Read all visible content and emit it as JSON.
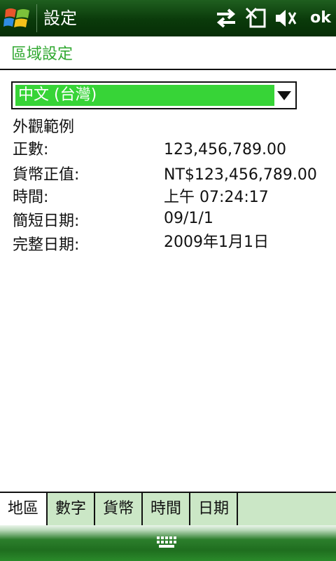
{
  "title_bar": {
    "app_title": "設定",
    "icons": [
      "windows-start-icon",
      "connectivity-icon",
      "no-sim-icon",
      "speaker-muted-icon"
    ],
    "ok_label": "ok"
  },
  "page": {
    "title": "區域設定"
  },
  "locale_select": {
    "value": "中文 (台灣)"
  },
  "sample": {
    "heading": "外觀範例",
    "rows": [
      {
        "label": "正數:",
        "value": "123,456,789.00"
      },
      {
        "label": "貨幣正值:",
        "value": "NT$123,456,789.00"
      },
      {
        "label": "時間:",
        "value": "上午 07:24:17"
      },
      {
        "label": "簡短日期:",
        "value": "09/1/1"
      },
      {
        "label": "完整日期:",
        "value": "2009年1月1日"
      }
    ]
  },
  "tabs": [
    {
      "label": "地區",
      "active": true
    },
    {
      "label": "數字",
      "active": false
    },
    {
      "label": "貨幣",
      "active": false
    },
    {
      "label": "時間",
      "active": false
    },
    {
      "label": "日期",
      "active": false
    }
  ],
  "colors": {
    "accent_green": "#31a831",
    "selection_green": "#37d437",
    "tab_bg": "#cbe7c6",
    "titlebar_dark": "#0a3a0a"
  }
}
